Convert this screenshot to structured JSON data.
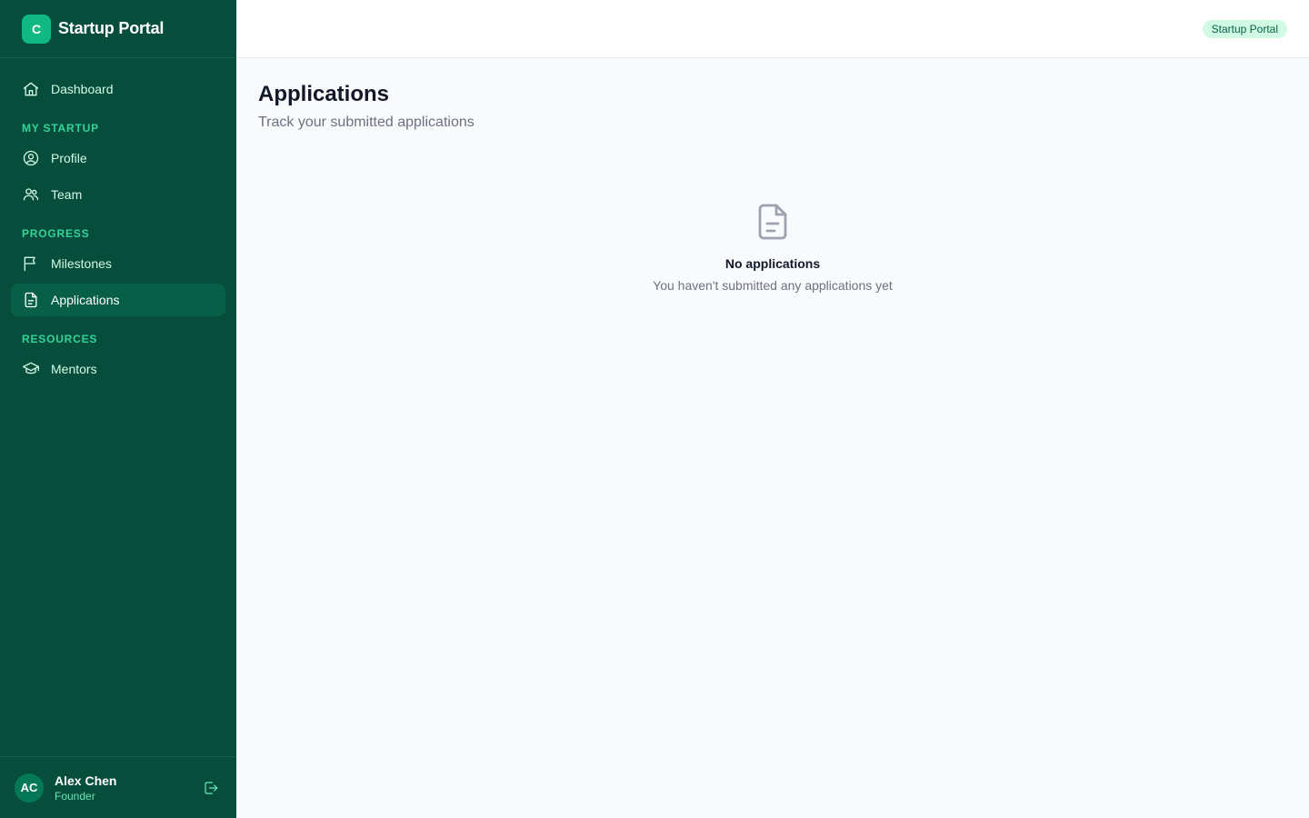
{
  "brand": {
    "logo_letter": "C",
    "name": "Startup Portal"
  },
  "nav": {
    "dashboard": "Dashboard",
    "sections": {
      "my_startup": "MY STARTUP",
      "progress": "PROGRESS",
      "resources": "RESOURCES"
    },
    "profile": "Profile",
    "team": "Team",
    "milestones": "Milestones",
    "applications": "Applications",
    "mentors": "Mentors",
    "active": "Applications"
  },
  "user": {
    "initials": "AC",
    "name": "Alex Chen",
    "role": "Founder"
  },
  "topbar": {
    "badge": "Startup Portal"
  },
  "page": {
    "title": "Applications",
    "subtitle": "Track your submitted applications"
  },
  "empty_state": {
    "icon": "document-icon",
    "title": "No applications",
    "message": "You haven't submitted any applications yet"
  },
  "colors": {
    "sidebar_bg": "#064e3b",
    "active_item": "#065f46",
    "accent": "#10b981",
    "section_label": "#34d399"
  }
}
